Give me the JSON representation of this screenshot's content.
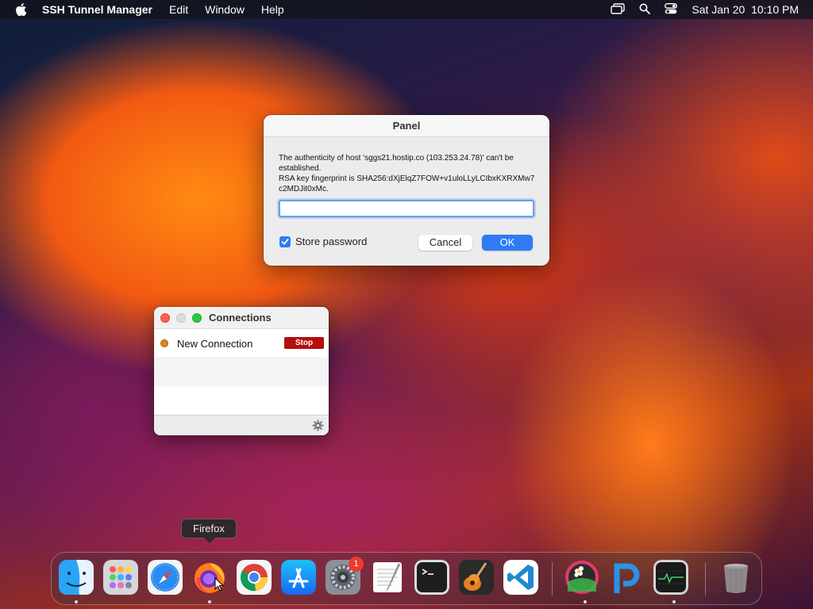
{
  "menubar": {
    "app_name": "SSH Tunnel Manager",
    "menus": [
      "Edit",
      "Window",
      "Help"
    ],
    "clock": "Sat Jan 20  10:10 PM"
  },
  "dialog": {
    "title": "Panel",
    "message_line1": "The authenticity of host 'sggs21.hostip.co (103.253.24.78)' can't be established.",
    "message_line2": "RSA key fingerprint is SHA256:dXjElqZ7FOW+v1uloLLyLCIbxKXRXMw7c2MDJit0xMc.",
    "input_value": "",
    "store_password_label": "Store password",
    "store_password_checked": true,
    "cancel_label": "Cancel",
    "ok_label": "OK"
  },
  "connections": {
    "title": "Connections",
    "items": [
      {
        "name": "New Connection",
        "action": "Stop",
        "status_color": "#e0841a"
      }
    ]
  },
  "dock": {
    "tooltip": "Firefox",
    "apps": [
      "Finder",
      "Launchpad",
      "Safari",
      "Firefox",
      "Chrome",
      "App Store",
      "System Preferences",
      "TextEdit",
      "Terminal",
      "GarageBand",
      "Visual Studio Code",
      "Flower App",
      "P App",
      "Activity Monitor",
      "Trash"
    ],
    "system_prefs_badge": "1"
  }
}
